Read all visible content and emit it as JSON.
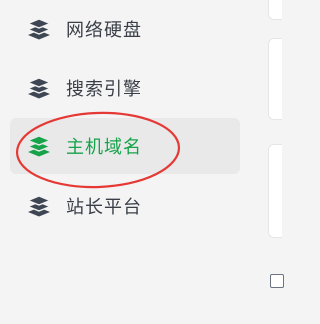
{
  "sidebar": {
    "items": [
      {
        "label": "网络硬盘",
        "icon": "layers-icon",
        "active": false
      },
      {
        "label": "搜索引擎",
        "icon": "layers-icon",
        "active": false
      },
      {
        "label": "主机域名",
        "icon": "layers-icon",
        "active": true
      },
      {
        "label": "站长平台",
        "icon": "layers-icon",
        "active": false
      }
    ]
  },
  "colors": {
    "text": "#3a3f47",
    "icon": "#3f4653",
    "active": "#16a34a",
    "active_bg": "#e9e9ea",
    "annotation": "#e53935",
    "background": "#f4f4f5"
  }
}
